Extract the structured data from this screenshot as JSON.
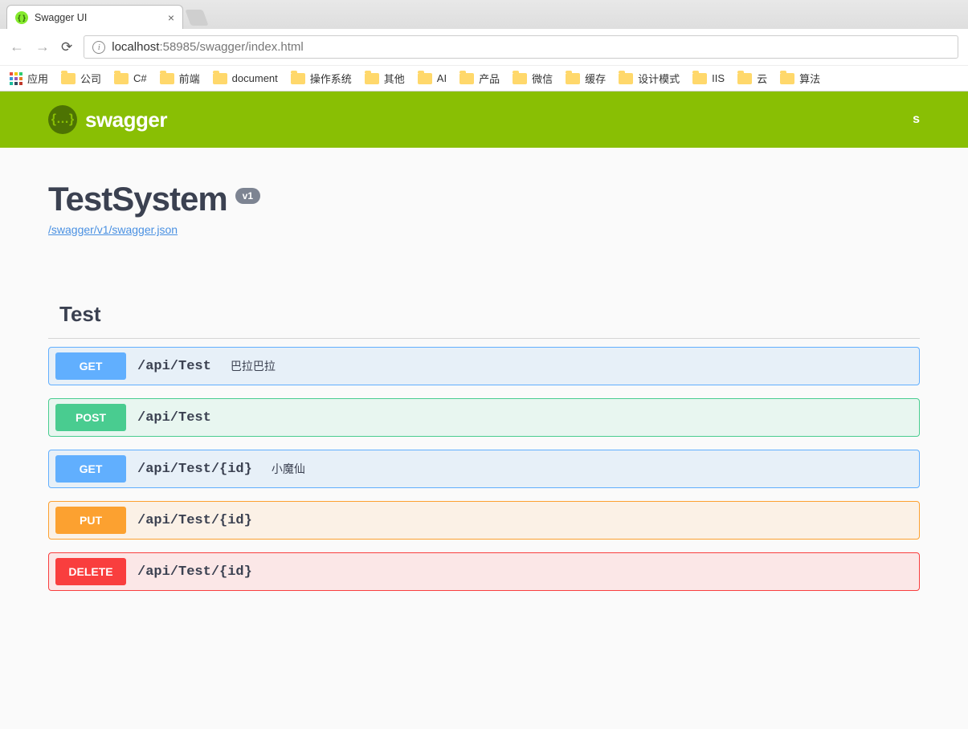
{
  "browser": {
    "tab_title": "Swagger UI",
    "url_host": "localhost",
    "url_port": ":58985",
    "url_path": "/swagger/index.html",
    "apps_label": "应用"
  },
  "bookmarks": [
    {
      "label": "公司"
    },
    {
      "label": "C#"
    },
    {
      "label": "前端"
    },
    {
      "label": "document"
    },
    {
      "label": "操作系统"
    },
    {
      "label": "其他"
    },
    {
      "label": "AI"
    },
    {
      "label": "产品"
    },
    {
      "label": "微信"
    },
    {
      "label": "缓存"
    },
    {
      "label": "设计模式"
    },
    {
      "label": "IIS"
    },
    {
      "label": "云"
    },
    {
      "label": "算法"
    }
  ],
  "swagger": {
    "brand": "swagger",
    "logo_glyph": "{…}",
    "right_cut": "s"
  },
  "api": {
    "title": "TestSystem",
    "version": "v1",
    "spec_link": "/swagger/v1/swagger.json"
  },
  "tag": {
    "name": "Test"
  },
  "operations": [
    {
      "method": "GET",
      "path": "/api/Test",
      "summary": "巴拉巴拉",
      "cls": "get"
    },
    {
      "method": "POST",
      "path": "/api/Test",
      "summary": "",
      "cls": "post"
    },
    {
      "method": "GET",
      "path": "/api/Test/{id}",
      "summary": "小魔仙",
      "cls": "get"
    },
    {
      "method": "PUT",
      "path": "/api/Test/{id}",
      "summary": "",
      "cls": "put"
    },
    {
      "method": "DELETE",
      "path": "/api/Test/{id}",
      "summary": "",
      "cls": "delete"
    }
  ]
}
